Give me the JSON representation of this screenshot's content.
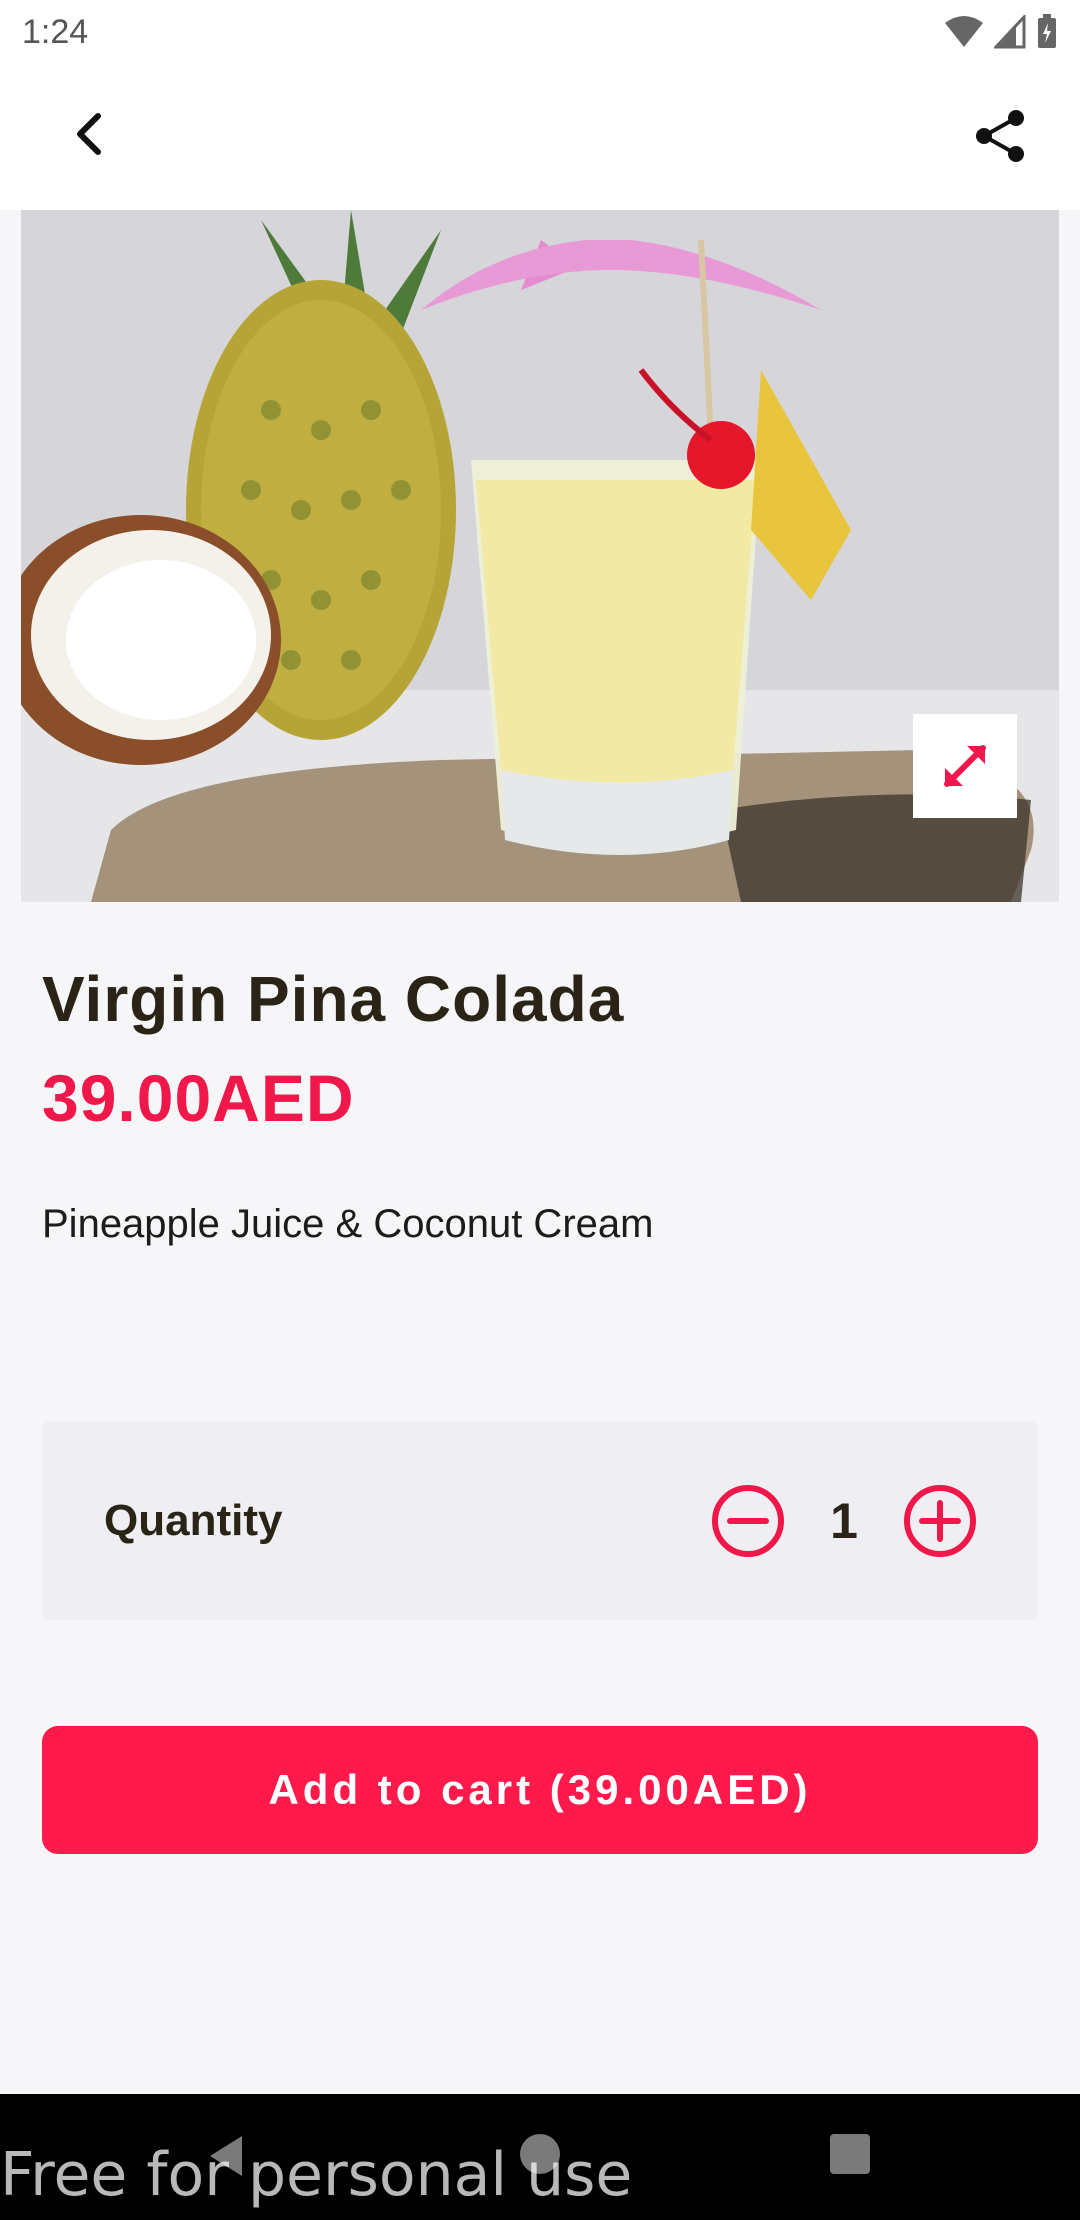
{
  "status_bar": {
    "time": "1:24"
  },
  "header": {
    "back_icon": "chevron-left-icon",
    "share_icon": "share-icon"
  },
  "hero": {
    "expand_icon": "expand-icon"
  },
  "product": {
    "title": "Virgin Pina Colada",
    "price": "39.00AED",
    "description": "Pineapple Juice & Coconut Cream"
  },
  "quantity": {
    "label": "Quantity",
    "value": "1",
    "minus_icon": "minus-circle-icon",
    "plus_icon": "plus-circle-icon"
  },
  "cart": {
    "button_label": "Add to cart (39.00AED)"
  },
  "overlay": {
    "watermark": "Free for personal use"
  },
  "colors": {
    "accent": "#ff1a4b",
    "text_dark": "#2a2416",
    "background": "#f6f6f8",
    "panel": "#efeef3"
  }
}
